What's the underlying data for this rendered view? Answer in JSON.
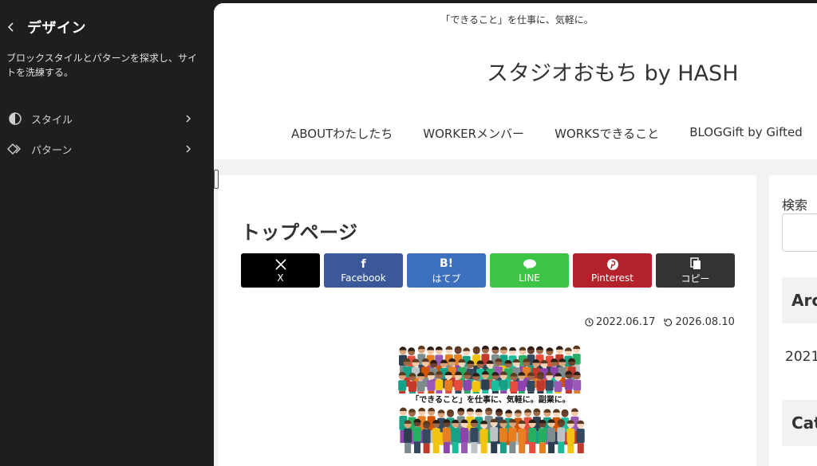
{
  "sidebar": {
    "title": "デザイン",
    "description": "ブロックスタイルとパターンを探求し、サイトを洗練する。",
    "items": [
      {
        "label": "スタイル",
        "icon": "contrast-icon"
      },
      {
        "label": "パターン",
        "icon": "pattern-icon"
      }
    ]
  },
  "site": {
    "tagline": "「できること」を仕事に、気軽に。",
    "title": "スタジオおもち by HASH",
    "nav": [
      "ABOUTわたしたち",
      "WORKERメンバー",
      "WORKSできること",
      "BLOGGift by Gifted"
    ]
  },
  "page": {
    "title": "トップページ",
    "share": [
      {
        "label": "X",
        "icon": "x-icon",
        "color": "#000000"
      },
      {
        "label": "Facebook",
        "icon": "facebook-icon",
        "color": "#3b5998"
      },
      {
        "label": "はてブ",
        "icon": "hatena-icon",
        "color": "#3c6fbd"
      },
      {
        "label": "LINE",
        "icon": "line-icon",
        "color": "#3ec444"
      },
      {
        "label": "Pinterest",
        "icon": "pinterest-icon",
        "color": "#b3222a"
      },
      {
        "label": "コピー",
        "icon": "copy-icon",
        "color": "#333333"
      }
    ],
    "published": "2022.06.17",
    "updated": "2026.08.10",
    "hero_caption": "「できること」を仕事に、気軽に。副業に。"
  },
  "widgets": {
    "search_label": "検索",
    "archive_heading": "Arc",
    "archive_year": "2021",
    "category_heading": "Cat"
  }
}
